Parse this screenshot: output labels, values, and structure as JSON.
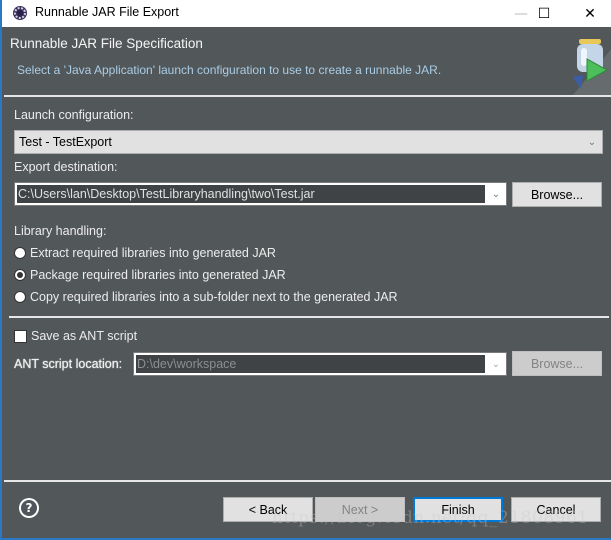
{
  "window": {
    "title": "Runnable JAR File Export",
    "controls": {
      "minimize": "—",
      "maximize": "☐",
      "close": "✕"
    }
  },
  "banner": {
    "heading": "Runnable JAR File Specification",
    "description": "Select a 'Java Application' launch configuration to use to create a runnable JAR.",
    "icon": "jar-export-wizard-icon"
  },
  "form": {
    "launch_configuration": {
      "label": "Launch configuration:",
      "value": "Test - TestExport"
    },
    "export_destination": {
      "label": "Export destination:",
      "value": "C:\\Users\\lan\\Desktop\\TestLibraryhandling\\two\\Test.jar",
      "browse_label": "Browse..."
    },
    "library_handling": {
      "label": "Library handling:",
      "options": [
        {
          "label": "Extract required libraries into generated JAR",
          "selected": false
        },
        {
          "label": "Package required libraries into generated JAR",
          "selected": true
        },
        {
          "label": "Copy required libraries into a sub-folder next to the generated JAR",
          "selected": false
        }
      ]
    },
    "ant": {
      "checkbox_label": "Save as ANT script",
      "checked": false,
      "location_label": "ANT script location:",
      "location_value": "D:\\dev\\workspace",
      "browse_label": "Browse...",
      "enabled": false
    }
  },
  "footer": {
    "help": "?",
    "back_label": "< Back",
    "next_label": "Next >",
    "finish_label": "Finish",
    "cancel_label": "Cancel"
  },
  "watermark": "https://blog.csdn.net/qq_21808961",
  "colors": {
    "background": "#52575a",
    "accent": "#0078d7",
    "description_text": "#a9cde6"
  }
}
